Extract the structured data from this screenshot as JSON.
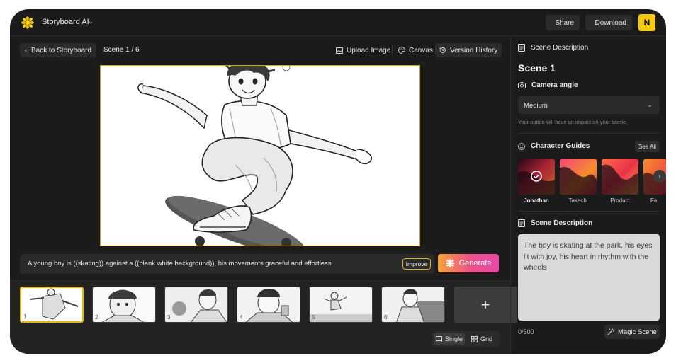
{
  "topbar": {
    "app_name": "Storyboard AI",
    "share_label": "Share",
    "download_label": "Download",
    "avatar_initial": "N",
    "accent_color": "#f6c90e"
  },
  "editor": {
    "back_label": "Back to Storyboard",
    "scene_counter": "Scene 1 / 6",
    "tools": {
      "upload_label": "Upload Image",
      "canvas_label": "Canvas",
      "version_label": "Version History"
    },
    "prompt": "A young boy is ((skating)) against a ((blank white background)), his movements graceful and effortless.",
    "improve_label": "Improve",
    "generate_label": "Generate"
  },
  "thumbnails": [
    {
      "num": "1",
      "selected": true
    },
    {
      "num": "2",
      "selected": false
    },
    {
      "num": "3",
      "selected": false
    },
    {
      "num": "4",
      "selected": false
    },
    {
      "num": "5",
      "selected": false
    },
    {
      "num": "6",
      "selected": false
    }
  ],
  "add_label": "+",
  "view_toggle": {
    "single_label": "Single",
    "grid_label": "Grid",
    "active": "Single"
  },
  "panel": {
    "header": "Scene Description",
    "scene_title": "Scene 1",
    "camera_label": "Camera angle",
    "camera_value": "Medium",
    "camera_hint": "Your option will have an impact on your scene.",
    "guides_label": "Character Guides",
    "see_all_label": "See All",
    "guides": [
      {
        "name": "Jonathan",
        "selected": true
      },
      {
        "name": "Takechi",
        "selected": false
      },
      {
        "name": "Product",
        "selected": false
      },
      {
        "name": "Fa",
        "selected": false
      }
    ],
    "desc_label": "Scene Description",
    "description": "The boy is skating at the park, his eyes lit with joy, his heart in rhythm with the wheels",
    "char_count": "0/500",
    "magic_label": "Magic Scene"
  },
  "icons": {
    "logo": "sun-flower-icon",
    "share": "share-icon",
    "download": "download-icon",
    "back": "chevron-left-icon",
    "upload": "image-icon",
    "canvas": "palette-icon",
    "version": "history-icon",
    "generate": "sparkle-icon",
    "doc": "document-icon",
    "camera": "camera-icon",
    "smile": "smile-icon",
    "magic": "magic-wand-icon",
    "single": "square-icon",
    "grid": "grid-icon"
  }
}
